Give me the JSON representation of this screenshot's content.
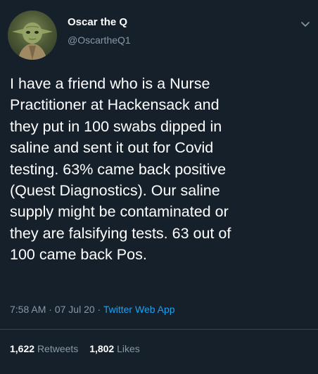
{
  "user": {
    "display_name": "Oscar the Q",
    "handle": "@OscartheQ1",
    "avatar_icon": "yoda-avatar"
  },
  "tweet": {
    "lines": [
      "I have a friend who is a Nurse",
      "Practitioner at Hackensack and",
      "they put in 100 swabs dipped in",
      "saline and sent it out for Covid",
      "testing. 63% came back positive",
      "(Quest Diagnostics). Our saline",
      "supply might be contaminated or",
      "they are falsifying tests. 63 out of",
      "100 came back Pos."
    ],
    "time": "7:58 AM",
    "date": "07 Jul 20",
    "separator": "·",
    "app": "Twitter Web App"
  },
  "stats": {
    "retweets_count": "1,622",
    "retweets_label": "Retweets",
    "likes_count": "1,802",
    "likes_label": "Likes"
  },
  "colors": {
    "background": "#15202b",
    "text": "#ffffff",
    "secondary": "#8899a6",
    "accent": "#1da1f2"
  }
}
